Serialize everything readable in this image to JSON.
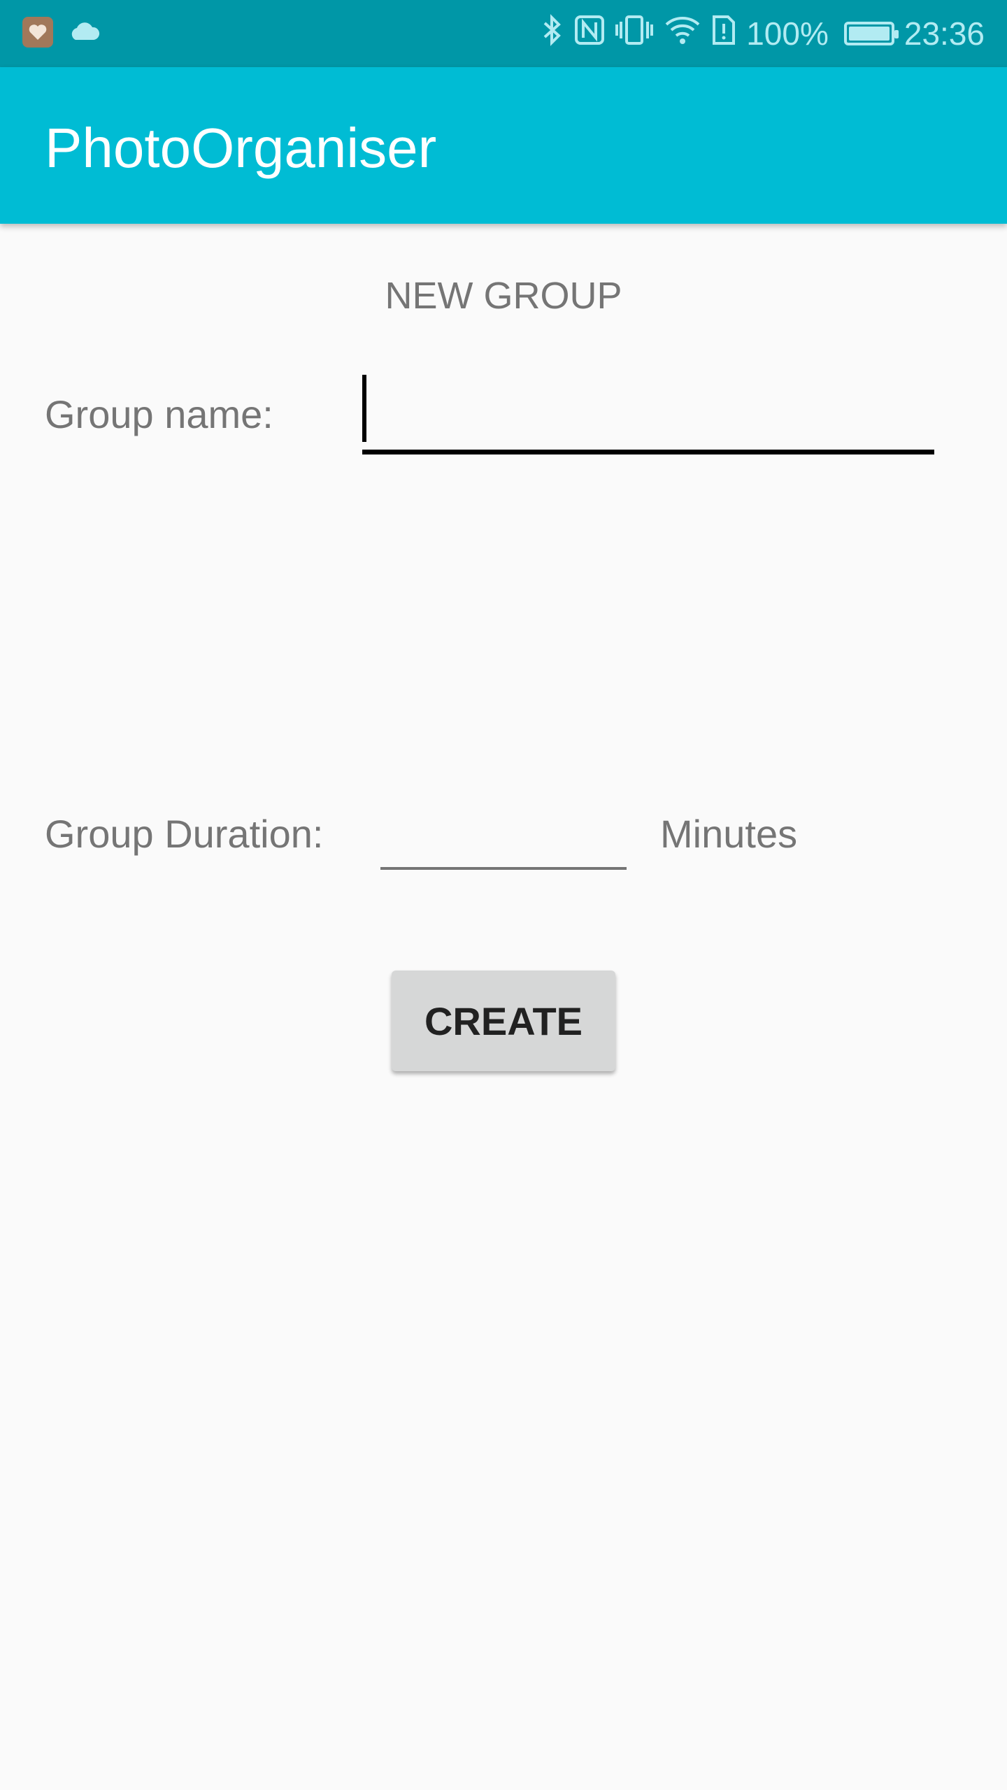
{
  "status_bar": {
    "battery_percent": "100%",
    "battery_level": 1.0,
    "time": "23:36",
    "icons": [
      "health-app-icon",
      "cloud-icon",
      "bluetooth-icon",
      "nfc-icon",
      "vibrate-icon",
      "wifi-icon",
      "sim-alert-icon",
      "battery-icon"
    ]
  },
  "app_bar": {
    "title": "PhotoOrganiser"
  },
  "form": {
    "title": "NEW GROUP",
    "name_label": "Group name:",
    "name_value": "",
    "duration_label": "Group Duration:",
    "duration_value": "",
    "duration_unit": "Minutes",
    "create_label": "CREATE"
  },
  "colors": {
    "status_bar": "#0097a7",
    "app_bar": "#00bcd4",
    "background": "#fafafa",
    "button": "#d6d7d7"
  }
}
